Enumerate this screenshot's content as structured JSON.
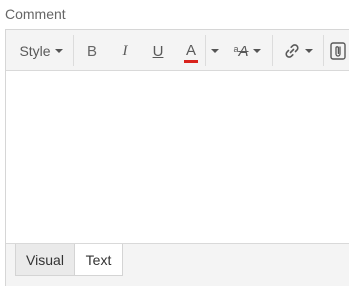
{
  "field": {
    "label": "Comment"
  },
  "toolbar": {
    "style_label": "Style",
    "bold_label": "B",
    "italic_label": "I",
    "underline_label": "U",
    "text_color_label": "A",
    "text_color_accent": "#d9221c",
    "font_size_small": "a",
    "font_size_label": "A",
    "icons": {
      "link": "link-icon",
      "attach": "attach-icon"
    }
  },
  "tabs": [
    {
      "label": "Visual",
      "active": false
    },
    {
      "label": "Text",
      "active": true
    }
  ]
}
